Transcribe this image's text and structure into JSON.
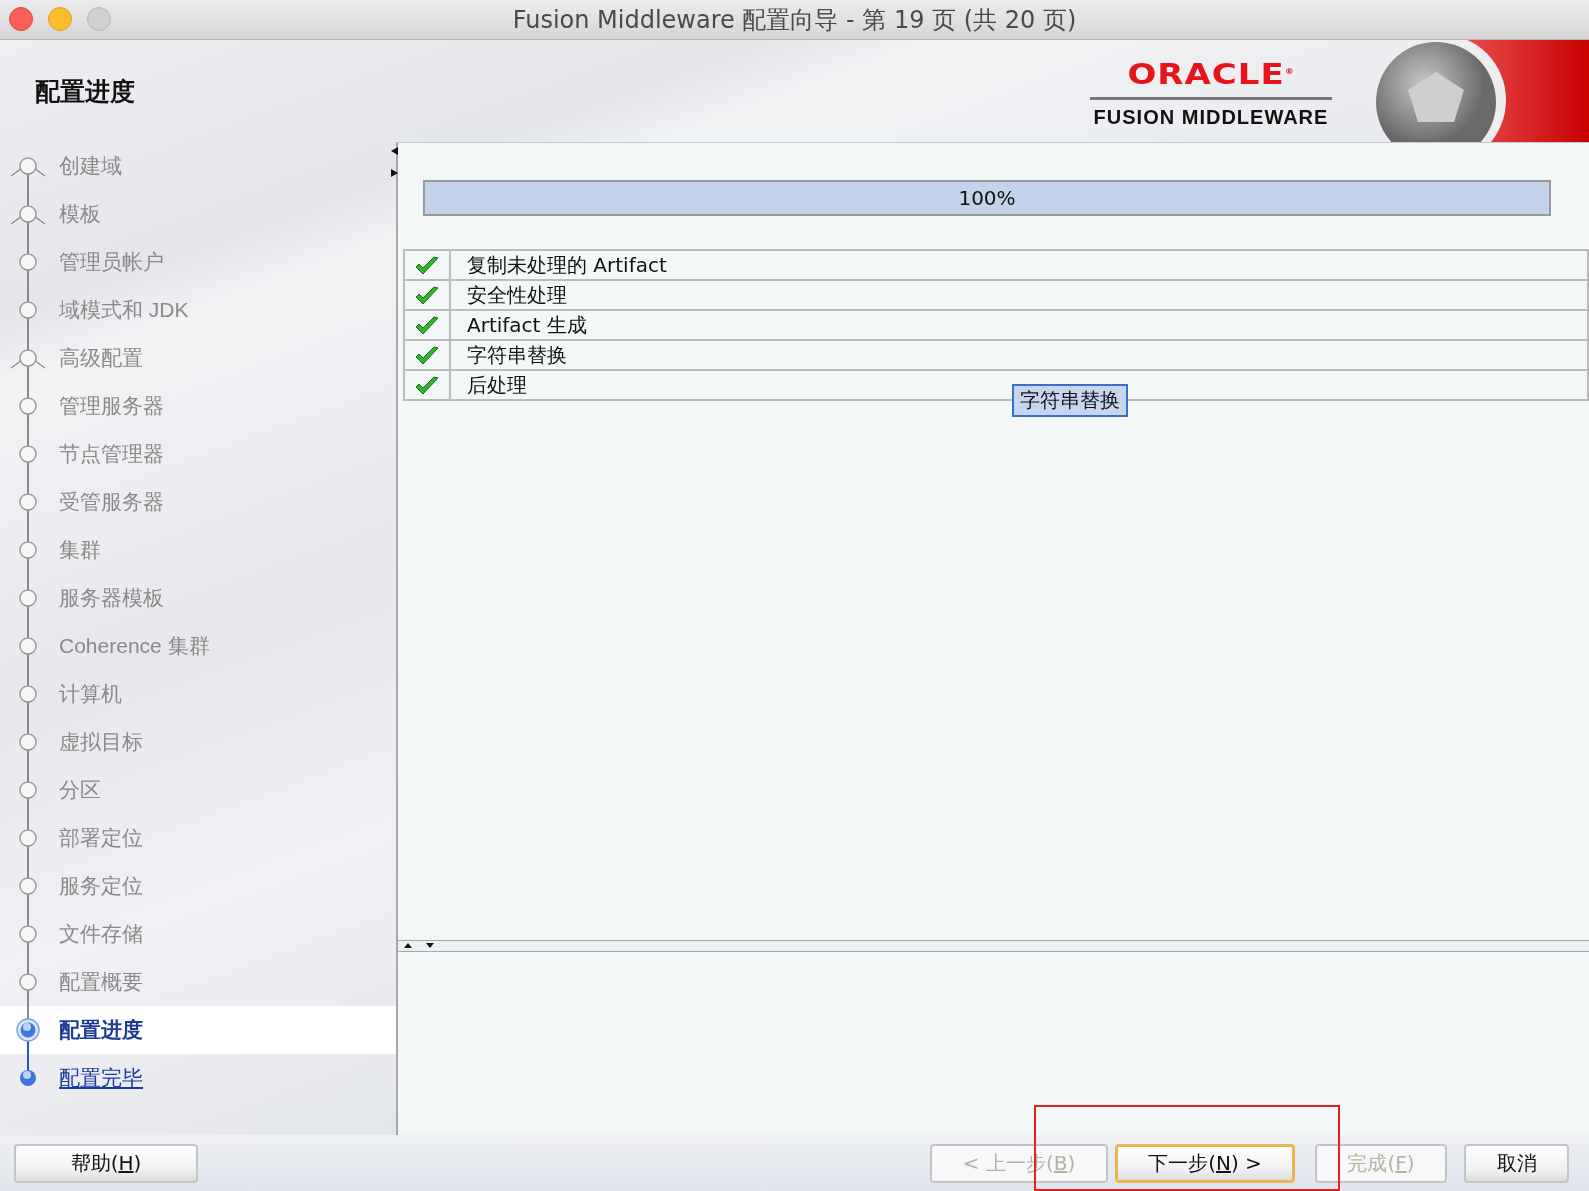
{
  "window": {
    "title": "Fusion Middleware 配置向导 - 第 19 页 (共 20 页)"
  },
  "page_title": "配置进度",
  "logo": {
    "brand": "ORACLE$^{®}$",
    "product": "FUSION MIDDLEWARE"
  },
  "steps": [
    {
      "label": "创建域",
      "kind": "fork",
      "selected": false
    },
    {
      "label": "模板",
      "kind": "fork",
      "selected": false
    },
    {
      "label": "管理员帐户",
      "kind": "node",
      "selected": false
    },
    {
      "label": "域模式和 JDK",
      "kind": "node",
      "selected": false
    },
    {
      "label": "高级配置",
      "kind": "fork",
      "selected": false
    },
    {
      "label": "管理服务器",
      "kind": "node",
      "selected": false
    },
    {
      "label": "节点管理器",
      "kind": "node",
      "selected": false
    },
    {
      "label": "受管服务器",
      "kind": "node",
      "selected": false
    },
    {
      "label": "集群",
      "kind": "node",
      "selected": false
    },
    {
      "label": "服务器模板",
      "kind": "node",
      "selected": false
    },
    {
      "label": "Coherence 集群",
      "kind": "node",
      "selected": false
    },
    {
      "label": "计算机",
      "kind": "node",
      "selected": false
    },
    {
      "label": "虚拟目标",
      "kind": "node",
      "selected": false
    },
    {
      "label": "分区",
      "kind": "node",
      "selected": false
    },
    {
      "label": "部署定位",
      "kind": "node",
      "selected": false
    },
    {
      "label": "服务定位",
      "kind": "node",
      "selected": false
    },
    {
      "label": "文件存储",
      "kind": "node",
      "selected": false
    },
    {
      "label": "配置概要",
      "kind": "node",
      "selected": false
    },
    {
      "label": "配置进度",
      "kind": "node",
      "selected": true
    },
    {
      "label": "配置完毕",
      "kind": "link",
      "selected": false
    }
  ],
  "progress": {
    "level": 1,
    "reading": "100%"
  },
  "tasks": [
    {
      "label": "复制未处理的 Artifact",
      "done": true
    },
    {
      "label": "安全性处理",
      "done": true
    },
    {
      "label": "Artifact 生成",
      "done": true
    },
    {
      "label": "字符串替换",
      "done": true
    },
    {
      "label": "后处理",
      "done": true
    }
  ],
  "tooltip": "字符串替换",
  "help_button": {
    "label_parts": [
      "帮助(",
      "H",
      ")"
    ]
  },
  "buttons": [
    {
      "label_parts": [
        "< 上一步(",
        "B",
        ")"
      ],
      "disabled": true,
      "default": false
    },
    {
      "label_parts": [
        "下一步(",
        "N",
        ") >"
      ],
      "disabled": false,
      "default": true
    },
    {
      "label_parts": [
        "完成(",
        "F",
        ")"
      ],
      "disabled": true,
      "default": false
    },
    {
      "label_parts": [
        "取消"
      ],
      "disabled": false,
      "default": false
    }
  ]
}
